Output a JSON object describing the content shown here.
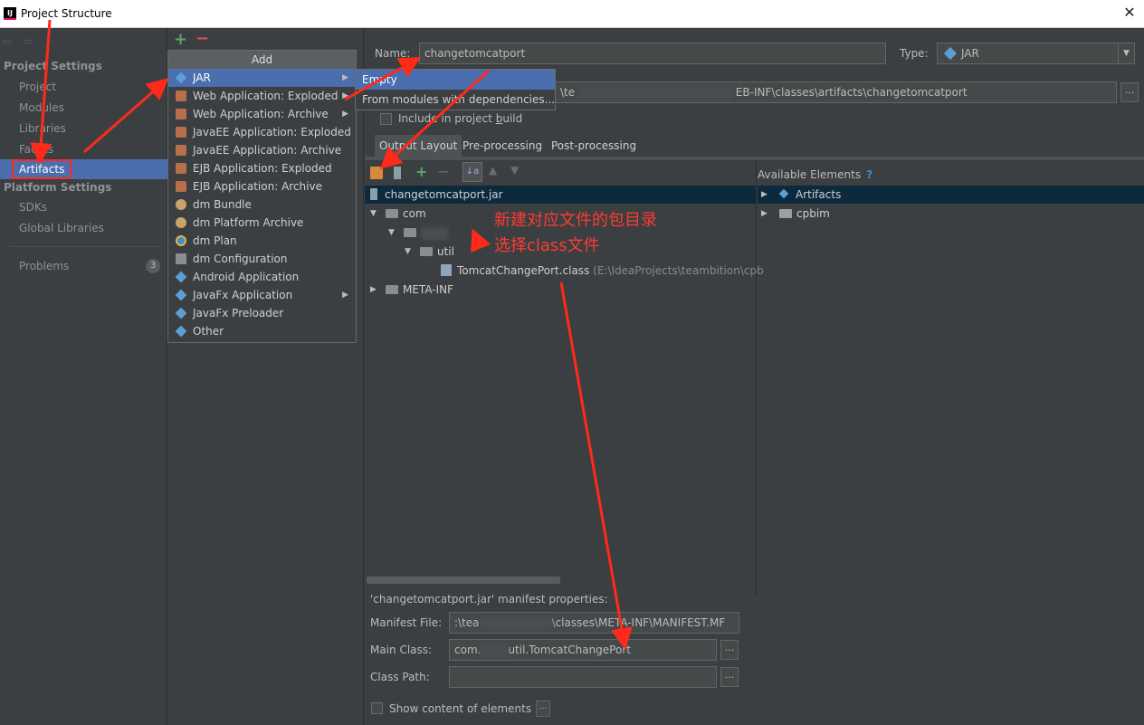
{
  "window": {
    "title": "Project Structure",
    "app_icon": "IJ",
    "close_label": "✕"
  },
  "sidebar": {
    "project_settings_label": "Project Settings",
    "project_items": [
      "Project",
      "Modules",
      "Libraries",
      "Facets",
      "Artifacts"
    ],
    "platform_settings_label": "Platform Settings",
    "platform_items": [
      "SDKs",
      "Global Libraries"
    ],
    "problems_label": "Problems",
    "problems_count": "3"
  },
  "middle_toolbar": {
    "add": "+",
    "remove": "−"
  },
  "add_popup": {
    "header": "Add",
    "items": [
      {
        "label": "JAR",
        "icon": "jar-icon",
        "submenu": true
      },
      {
        "label": "Web Application: Exploded",
        "icon": "web-app-icon",
        "submenu": true
      },
      {
        "label": "Web Application: Archive",
        "icon": "web-app-icon",
        "submenu": true
      },
      {
        "label": "JavaEE Application: Exploded",
        "icon": "javaee-icon",
        "submenu": false
      },
      {
        "label": "JavaEE Application: Archive",
        "icon": "javaee-icon",
        "submenu": false
      },
      {
        "label": "EJB Application: Exploded",
        "icon": "ejb-icon",
        "submenu": false
      },
      {
        "label": "EJB Application: Archive",
        "icon": "ejb-icon",
        "submenu": false
      },
      {
        "label": "dm Bundle",
        "icon": "dm-bundle-icon",
        "submenu": false
      },
      {
        "label": "dm Platform Archive",
        "icon": "dm-bundle-icon",
        "submenu": false
      },
      {
        "label": "dm Plan",
        "icon": "dm-plan-icon",
        "submenu": false
      },
      {
        "label": "dm Configuration",
        "icon": "config-icon",
        "submenu": false
      },
      {
        "label": "Android Application",
        "icon": "jar-icon",
        "submenu": false
      },
      {
        "label": "JavaFx Application",
        "icon": "jar-icon",
        "submenu": true
      },
      {
        "label": "JavaFx Preloader",
        "icon": "jar-icon",
        "submenu": false
      },
      {
        "label": "Other",
        "icon": "jar-icon",
        "submenu": false
      }
    ]
  },
  "sub_popup": {
    "items": [
      "Empty",
      "From modules with dependencies..."
    ]
  },
  "form": {
    "name_label": "Name:",
    "name_value": "changetomcatport",
    "type_label": "Type:",
    "type_value": "JAR",
    "output_dir_prefix": "\\te",
    "output_dir_suffix": "EB-INF\\classes\\artifacts\\changetomcatport",
    "include_build_label": "Include in project build"
  },
  "tabs": [
    "Output Layout",
    "Pre-processing",
    "Post-processing"
  ],
  "layout_tree": {
    "root": "changetomcatport.jar",
    "com": "com",
    "util": "util",
    "class_file": "TomcatChangePort.class",
    "class_path_hint": "(E:\\IdeaProjects\\teambition\\cpb",
    "meta_inf": "META-INF"
  },
  "available": {
    "title": "Available Elements",
    "help": "?",
    "items": [
      "Artifacts",
      "cpbim"
    ]
  },
  "manifest": {
    "title": "'changetomcatport.jar' manifest properties:",
    "manifest_file_label": "Manifest File:",
    "manifest_file_prefix": ":\\tea",
    "manifest_file_suffix": "\\classes\\META-INF\\MANIFEST.MF",
    "main_class_label": "Main Class:",
    "main_class_prefix": "com.",
    "main_class_suffix": "util.TomcatChangePort",
    "class_path_label": "Class Path:",
    "class_path_value": "",
    "show_content_label": "Show content of elements",
    "dots": "..."
  },
  "annotation": {
    "line1": "新建对应文件的包目录",
    "line2": "选择class文件",
    "color": "#ff3b30"
  }
}
